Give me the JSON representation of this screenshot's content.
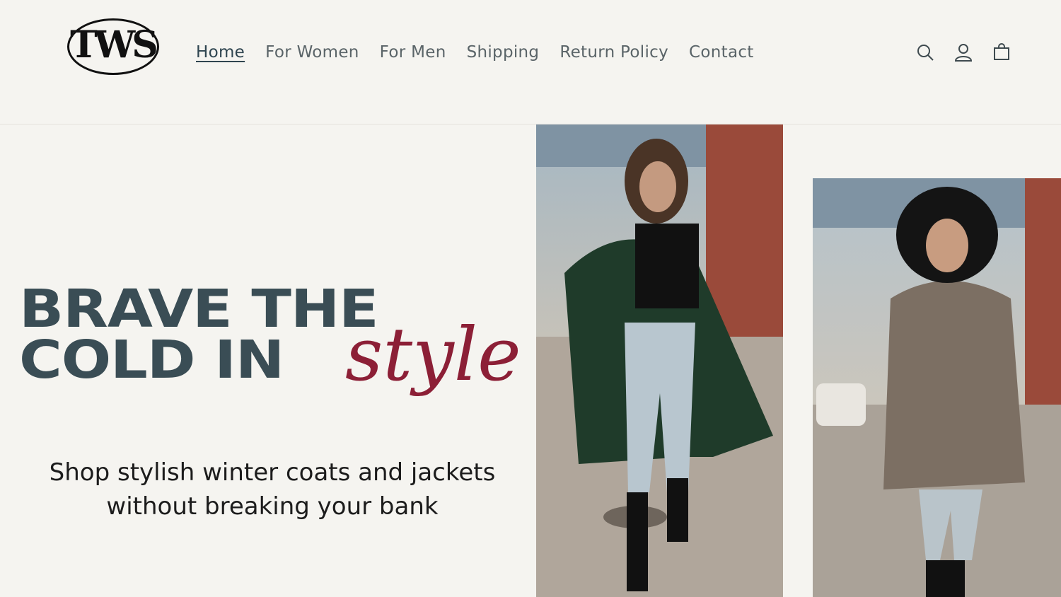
{
  "brand": {
    "logo_text": "TWS"
  },
  "nav": {
    "items": [
      {
        "label": "Home",
        "active": true
      },
      {
        "label": "For Women",
        "active": false
      },
      {
        "label": "For Men",
        "active": false
      },
      {
        "label": "Shipping",
        "active": false
      },
      {
        "label": "Return Policy",
        "active": false
      },
      {
        "label": "Contact",
        "active": false
      }
    ]
  },
  "header_icons": [
    "search-icon",
    "account-icon",
    "cart-icon"
  ],
  "hero": {
    "headline_line1": "BRAVE THE",
    "headline_line2": "COLD IN",
    "headline_script": "style",
    "tagline_line1": "Shop stylish winter coats and jackets",
    "tagline_line2": "without breaking your bank"
  },
  "colors": {
    "background": "#f5f4f0",
    "headline": "#3a4d55",
    "accent_script": "#8c1f36",
    "nav_text": "#5a6468"
  }
}
